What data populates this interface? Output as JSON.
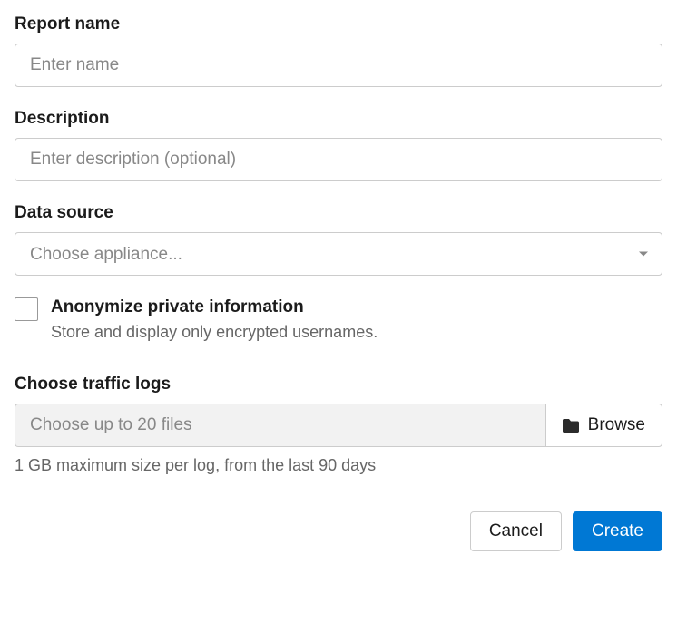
{
  "report_name": {
    "label": "Report name",
    "placeholder": "Enter name",
    "value": ""
  },
  "description": {
    "label": "Description",
    "placeholder": "Enter description (optional)",
    "value": ""
  },
  "data_source": {
    "label": "Data source",
    "placeholder": "Choose appliance...",
    "value": ""
  },
  "anonymize": {
    "label": "Anonymize private information",
    "sub": "Store and display only encrypted usernames.",
    "checked": false
  },
  "traffic_logs": {
    "label": "Choose traffic logs",
    "placeholder": "Choose up to 20 files",
    "browse": "Browse",
    "hint": "1 GB maximum size per log, from the last 90 days"
  },
  "actions": {
    "cancel": "Cancel",
    "create": "Create"
  }
}
